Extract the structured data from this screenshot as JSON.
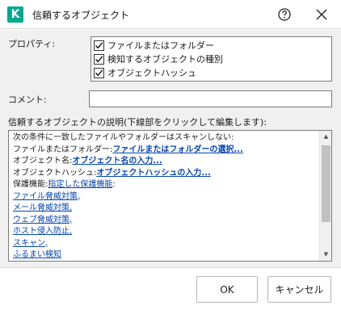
{
  "window": {
    "title": "信頼するオブジェクト",
    "logo_letter": "K",
    "accent_color": "#00a88e"
  },
  "properties": {
    "label": "プロパティ:",
    "options": [
      {
        "label": "ファイルまたはフォルダー",
        "checked": true
      },
      {
        "label": "検知するオブジェクトの種別",
        "checked": true
      },
      {
        "label": "オブジェクトハッシュ",
        "checked": true
      }
    ]
  },
  "comment": {
    "label": "コメント:",
    "value": ""
  },
  "description": {
    "label": "信頼するオブジェクトの説明(下線部をクリックして編集します):",
    "intro": "次の条件に一致したファイルやフォルダーはスキャンしない:",
    "file_label": "ファイルまたはフォルダー:",
    "file_link": "ファイルまたはフォルダーの選択...",
    "object_label": "オブジェクト名:",
    "object_link": "オブジェクト名の入力...",
    "hash_label": "オブジェクトハッシュ:",
    "hash_link": "オブジェクトハッシュの入力...",
    "scope_label": "保護機能:",
    "scope_link": "指定した保護機能",
    "scope_suffix": ":",
    "components": [
      "ファイル脅威対策,",
      "メール脅威対策,",
      "ウェブ脅威対策,",
      "ホスト侵入防止,",
      "スキャン,",
      "ふるまい検知"
    ]
  },
  "footer": {
    "ok_label": "OK",
    "cancel_label": "キャンセル"
  }
}
